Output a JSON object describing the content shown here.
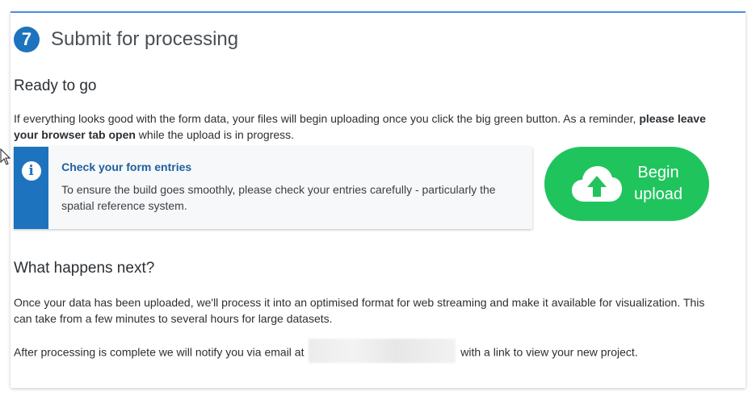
{
  "step": {
    "number": "7",
    "title": "Submit for processing"
  },
  "ready": {
    "heading": "Ready to go",
    "text_before": "If everything looks good with the form data, your files will begin uploading once you click the big green button. As a reminder, ",
    "text_bold": "please leave your browser tab open",
    "text_after": " while the upload is in progress."
  },
  "notice": {
    "icon": "info-icon",
    "title": "Check your form entries",
    "text": "To ensure the build goes smoothly, please check your entries carefully - particularly the spatial reference system."
  },
  "upload_button": {
    "icon": "cloud-upload-icon",
    "line1": "Begin",
    "line2": "upload"
  },
  "next": {
    "heading": "What happens next?",
    "para1": "Once your data has been uploaded, we'll process it into an optimised format for web streaming and make it available for visualization. This can take from a few minutes to several hours for large datasets.",
    "para2_before": "After processing is complete we will notify you via email at",
    "para2_after": "with a link to view your new project."
  },
  "colors": {
    "accent_blue": "#1e73be",
    "button_green": "#20c45d",
    "top_border": "#4a90e2"
  }
}
